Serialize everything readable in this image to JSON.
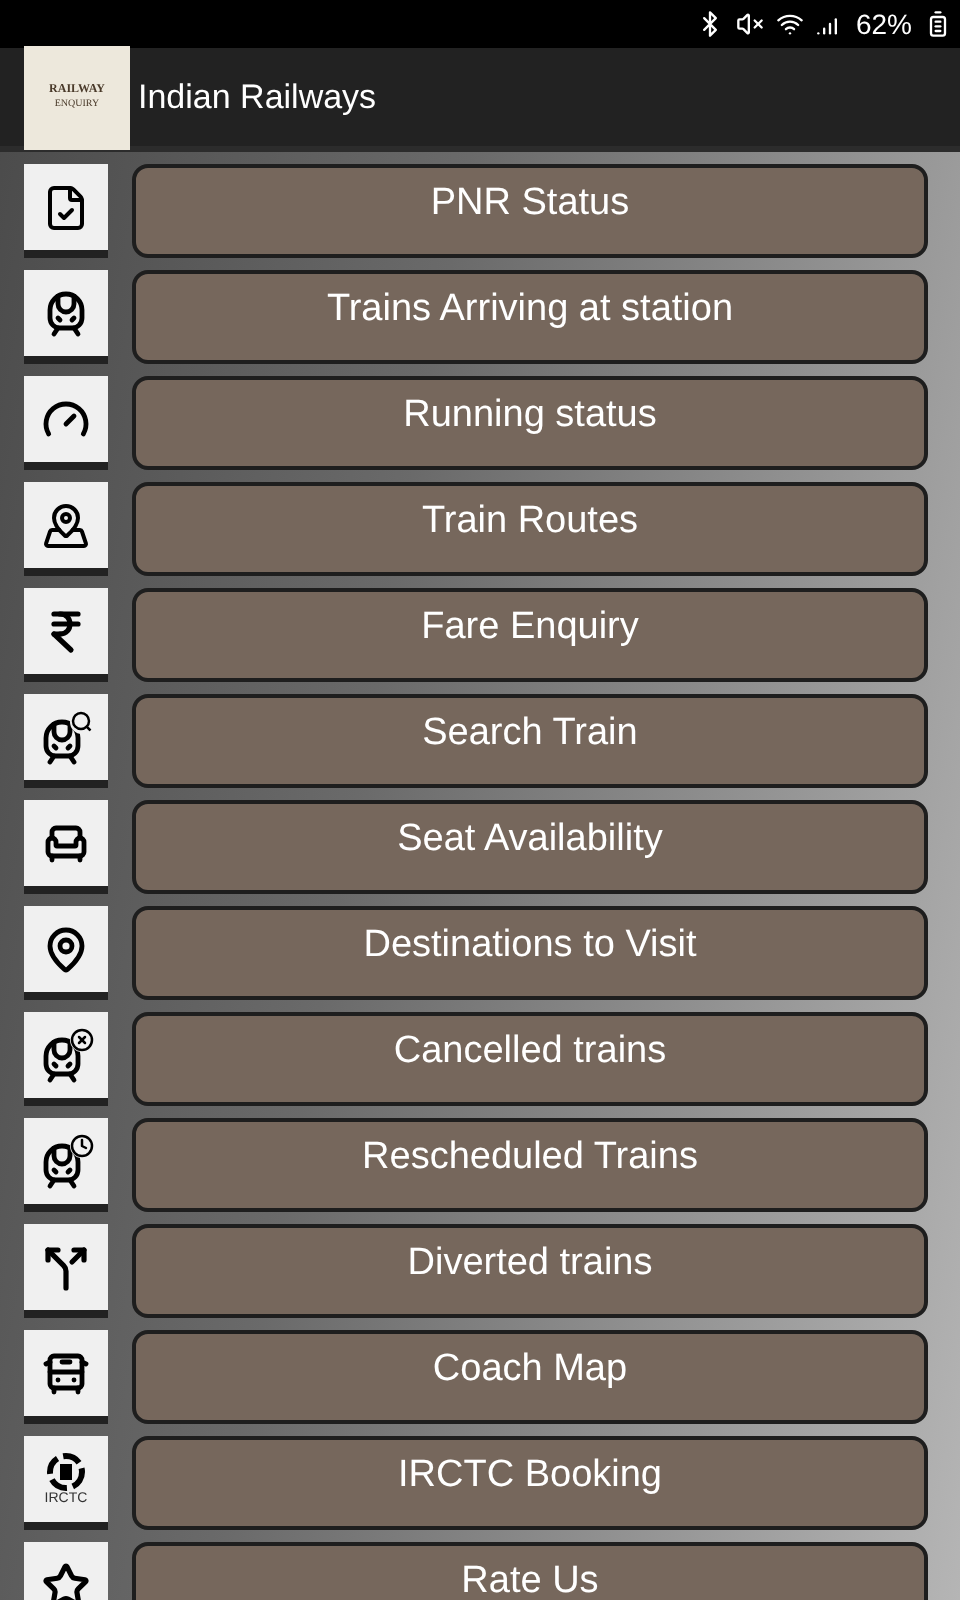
{
  "status_bar": {
    "battery": "62%"
  },
  "app_bar": {
    "logo_text": [
      "RAILWAY",
      "ENQUIRY"
    ],
    "title": "Indian Railways"
  },
  "menu": [
    {
      "label": "PNR Status",
      "kind": "document"
    },
    {
      "label": "Trains Arriving at station",
      "kind": "train"
    },
    {
      "label": "Running status",
      "kind": "gauge"
    },
    {
      "label": "Train Routes",
      "kind": "map"
    },
    {
      "label": "Fare Enquiry",
      "kind": "rupee"
    },
    {
      "label": "Search Train",
      "kind": "train-search"
    },
    {
      "label": "Seat Availability",
      "kind": "seat"
    },
    {
      "label": "Destinations to Visit",
      "kind": "pin"
    },
    {
      "label": "Cancelled trains",
      "kind": "train-cancel"
    },
    {
      "label": "Rescheduled Trains",
      "kind": "train-clock"
    },
    {
      "label": "Diverted trains",
      "kind": "divert"
    },
    {
      "label": "Coach Map",
      "kind": "coach"
    },
    {
      "label": "IRCTC Booking",
      "kind": "irctc",
      "icon_text": "IRCTC"
    },
    {
      "label": "Rate Us",
      "kind": "star"
    }
  ]
}
